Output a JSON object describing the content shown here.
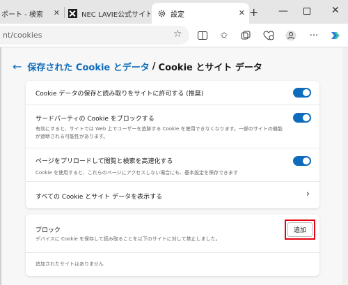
{
  "tabs": [
    {
      "title": "ポート - 検索"
    },
    {
      "title": "NEC LAVIE公式サイト > サ"
    },
    {
      "title": "設定"
    }
  ],
  "window": {
    "new_tab": "+",
    "minimize": "—",
    "close": "✕"
  },
  "address_bar": {
    "url": "nt/cookies"
  },
  "toolbar_icons": [
    "star-icon",
    "split-screen-icon",
    "favorites-icon",
    "collections-icon",
    "extensions-icon",
    "profile-icon",
    "more-icon",
    "copilot-icon"
  ],
  "breadcrumb": {
    "back": "←",
    "parent": "保存された Cookie とデータ",
    "separator": "/",
    "current": "Cookie とサイト データ"
  },
  "settings": [
    {
      "title": "Cookie データの保存と読み取りをサイトに許可する (推奨)",
      "description": "",
      "enabled": true
    },
    {
      "title": "サードパーティの Cookie をブロックする",
      "description": "有効にすると、サイトでは Web 上でユーザーを追跡する Cookie を使用できなくなります。一部のサイトの機能が遮断される可能性があります。",
      "enabled": true
    },
    {
      "title": "ページをプリロードして閲覧と検索を高速化する",
      "description": "Cookie を使用すると、これらのページにアクセスしない場合にも、基本設定を保存できます",
      "enabled": true
    }
  ],
  "see_all": {
    "label": "すべての Cookie とサイト データを表示する"
  },
  "block": {
    "title": "ブロック",
    "description": "デバイスに Cookie を保存して読み取ることを以下のサイトに対して禁止しました。",
    "add_label": "追加",
    "empty_text": "追加されたサイトはありません"
  },
  "colors": {
    "accent": "#0f6cbd",
    "highlight": "#e60012"
  }
}
